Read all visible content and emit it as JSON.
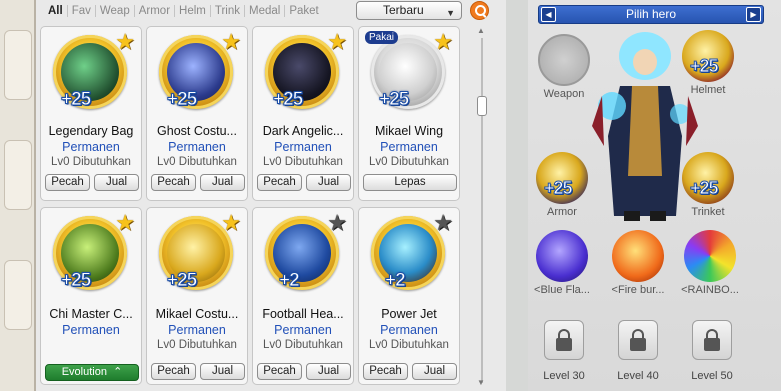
{
  "filters": [
    "All",
    "Fav",
    "Weap",
    "Armor",
    "Helm",
    "Trink",
    "Medal",
    "Paket"
  ],
  "active_filter": "All",
  "sort": {
    "value": "Terbaru"
  },
  "icons": {
    "search": "search-icon",
    "lock": "lock-icon"
  },
  "colors": {
    "accent_blue": "#2150b8",
    "header_blue": "#2f5fc3",
    "evolution_green": "#2a8c38",
    "star_gold": "#f7c21b"
  },
  "items": [
    {
      "name": "Legendary Bag",
      "plus": "+25",
      "duration": "Permanen",
      "requirement": "Lv0 Dibutuhkan",
      "star": "gold",
      "btn1": "Pecah",
      "btn2": "Jual",
      "icon": "bag-icon"
    },
    {
      "name": "Ghost Costu...",
      "plus": "+25",
      "duration": "Permanen",
      "requirement": "Lv0 Dibutuhkan",
      "star": "gold",
      "btn1": "Pecah",
      "btn2": "Jual",
      "icon": "ghost-costume-icon"
    },
    {
      "name": "Dark Angelic...",
      "plus": "+25",
      "duration": "Permanen",
      "requirement": "Lv0 Dibutuhkan",
      "star": "gold",
      "btn1": "Pecah",
      "btn2": "Jual",
      "icon": "dark-wing-icon"
    },
    {
      "name": "Mikael Wing",
      "plus": "+25",
      "duration": "Permanen",
      "requirement": "Lv0 Dibutuhkan",
      "star": "gold",
      "badge": "Pakai",
      "btn1": "Lepas",
      "icon": "white-wing-icon"
    },
    {
      "name": "Chi Master C...",
      "plus": "+25",
      "duration": "Permanen",
      "requirement": "",
      "star": "gold",
      "evolution": "Evolution",
      "icon": "chi-master-icon"
    },
    {
      "name": "Mikael Costu...",
      "plus": "+25",
      "duration": "Permanen",
      "requirement": "Lv0 Dibutuhkan",
      "star": "gold",
      "btn1": "Pecah",
      "btn2": "Jual",
      "icon": "gold-costume-icon"
    },
    {
      "name": "Football Hea...",
      "plus": "+2",
      "duration": "Permanen",
      "requirement": "Lv0 Dibutuhkan",
      "star": "dark",
      "btn1": "Pecah",
      "btn2": "Jual",
      "icon": "football-headband-icon"
    },
    {
      "name": "Power Jet",
      "plus": "+2",
      "duration": "Permanen",
      "requirement": "Lv0 Dibutuhkan",
      "star": "dark",
      "btn1": "Pecah",
      "btn2": "Jual",
      "icon": "power-jet-icon"
    }
  ],
  "hero": {
    "selector_label": "Pilih hero",
    "slots": {
      "weapon": {
        "label": "Weapon",
        "plus": ""
      },
      "helmet": {
        "label": "Helmet",
        "plus": "+25"
      },
      "armor": {
        "label": "Armor",
        "plus": "+25"
      },
      "trinket": {
        "label": "Trinket",
        "plus": "+25"
      }
    },
    "pets": [
      {
        "label": "<Blue Fla...",
        "icon": "blue-flame-pet-icon"
      },
      {
        "label": "<Fire bur...",
        "icon": "fire-pet-icon"
      },
      {
        "label": "<RAINBO...",
        "icon": "rainbow-pet-icon"
      }
    ],
    "locked": [
      {
        "label": "Level 30"
      },
      {
        "label": "Level 40"
      },
      {
        "label": "Level 50"
      }
    ]
  }
}
